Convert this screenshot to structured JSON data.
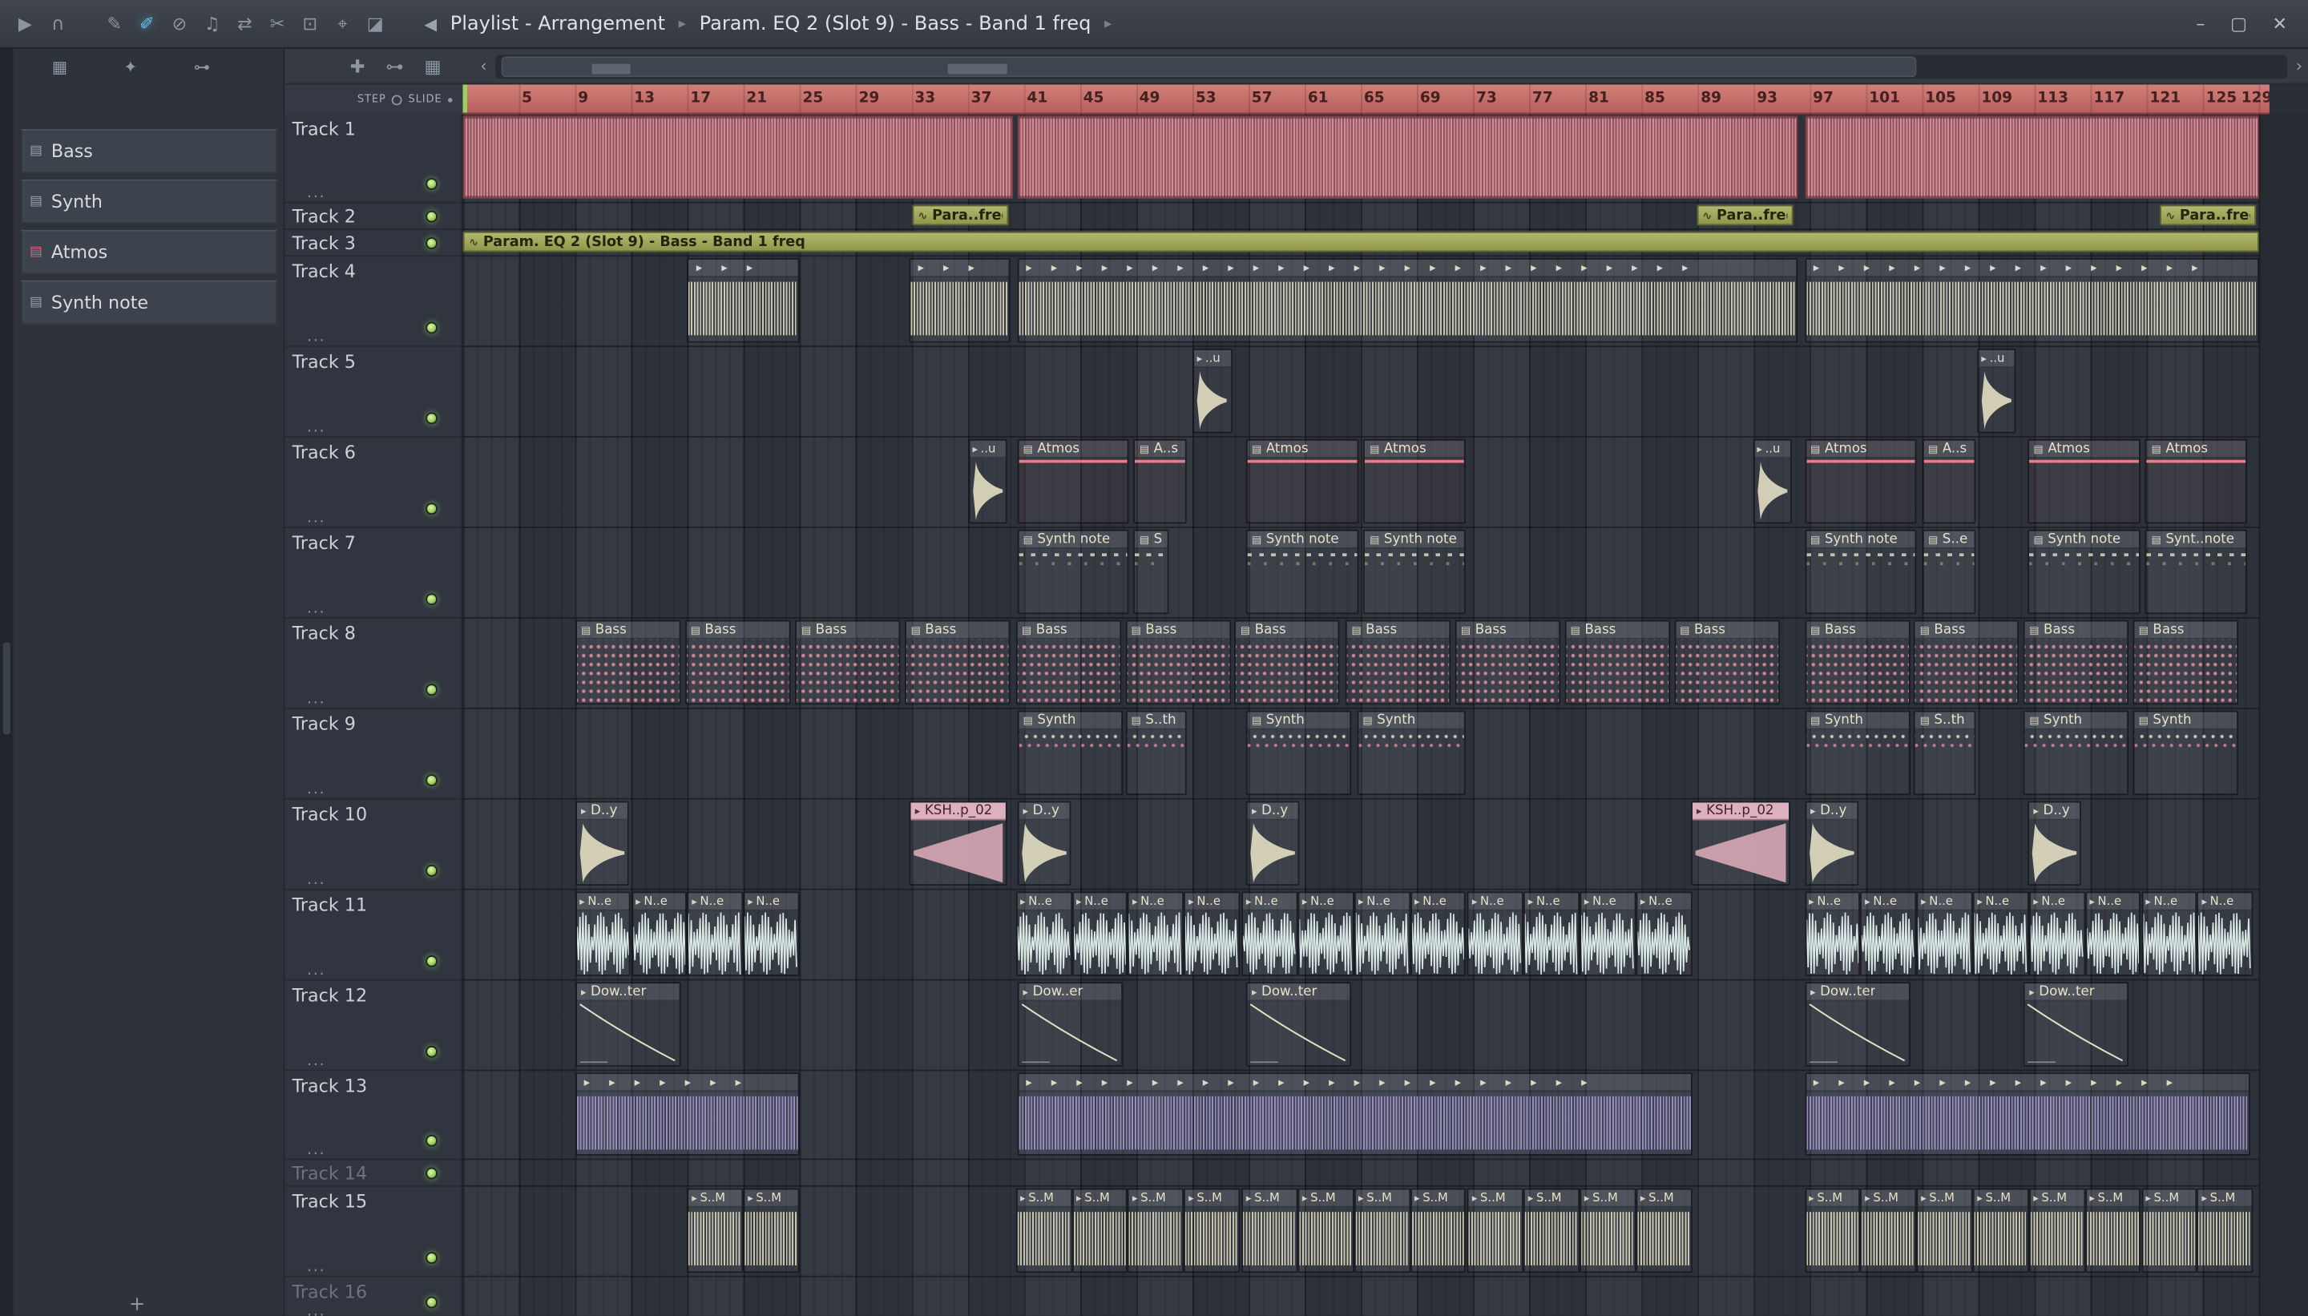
{
  "titlebar": {
    "breadcrumb": [
      "Playlist - Arrangement",
      "Param. EQ 2 (Slot 9) - Bass - Band 1 freq"
    ],
    "sep_glyph": "▸",
    "speaker_glyph": "◀",
    "tools": [
      {
        "name": "play-icon",
        "glyph": "▶"
      },
      {
        "name": "headphones-icon",
        "glyph": "∩"
      },
      {
        "name": "draw-icon",
        "glyph": "✎",
        "gap": true
      },
      {
        "name": "paint-icon",
        "glyph": "✐",
        "accent": "#5fc2ee"
      },
      {
        "name": "delete-icon",
        "glyph": "⊘"
      },
      {
        "name": "mute-icon",
        "glyph": "♫"
      },
      {
        "name": "slip-icon",
        "glyph": "⇄"
      },
      {
        "name": "slice-icon",
        "glyph": "✂"
      },
      {
        "name": "select-icon",
        "glyph": "⊡"
      },
      {
        "name": "zoom-icon",
        "glyph": "⌖"
      },
      {
        "name": "playback-icon",
        "glyph": "◪"
      }
    ],
    "window_buttons": [
      {
        "name": "minimize-button",
        "glyph": "–"
      },
      {
        "name": "maximize-button",
        "glyph": "▢"
      },
      {
        "name": "close-button",
        "glyph": "✕"
      }
    ]
  },
  "picker": {
    "tabs": [
      {
        "name": "pattern-picker-icon",
        "glyph": "▦"
      },
      {
        "name": "audio-picker-icon",
        "glyph": "✦"
      },
      {
        "name": "automation-picker-icon",
        "glyph": "⊶"
      }
    ],
    "items": [
      {
        "label": "Bass",
        "color": "#97a1ac"
      },
      {
        "label": "Synth",
        "color": "#97a1ac"
      },
      {
        "label": "Atmos",
        "color": "#d76872"
      },
      {
        "label": "Synth note",
        "color": "#97a1ac"
      }
    ],
    "add_label": "+"
  },
  "playlist": {
    "tools": [
      {
        "name": "snap-icon",
        "glyph": "✚"
      },
      {
        "name": "slide-icon",
        "glyph": "⊶"
      },
      {
        "name": "grid-icon",
        "glyph": "▦"
      }
    ],
    "scroll_left_glyph": "‹",
    "scroll_right_glyph": "›",
    "step_label": "STEP",
    "slide_label": "SLIDE",
    "ruler_numbers": [
      5,
      9,
      13,
      17,
      21,
      25,
      29,
      33,
      37,
      41,
      45,
      49,
      53,
      57,
      61,
      65,
      69,
      73,
      77,
      81,
      85,
      89,
      93,
      97,
      101,
      105,
      109,
      113,
      117,
      121,
      125,
      129
    ],
    "tracks": [
      {
        "name": "Track 1"
      },
      {
        "name": "Track 2"
      },
      {
        "name": "Track 3"
      },
      {
        "name": "Track 4"
      },
      {
        "name": "Track 5"
      },
      {
        "name": "Track 6"
      },
      {
        "name": "Track 7"
      },
      {
        "name": "Track 8"
      },
      {
        "name": "Track 9"
      },
      {
        "name": "Track 10"
      },
      {
        "name": "Track 11"
      },
      {
        "name": "Track 12"
      },
      {
        "name": "Track 13"
      },
      {
        "name": "Track 14",
        "dim": true
      },
      {
        "name": "Track 15"
      },
      {
        "name": "Track 16",
        "dim": true
      }
    ],
    "clips": [
      {
        "t": 0,
        "s": 1,
        "l": 39.2,
        "k": "pink"
      },
      {
        "t": 0,
        "s": 40.5,
        "l": 55.6,
        "k": "pink"
      },
      {
        "t": 0,
        "s": 96.6,
        "l": 32.4,
        "k": "pink"
      },
      {
        "t": 1,
        "s": 33,
        "l": 6.9,
        "k": "auto",
        "label": "Para..freq"
      },
      {
        "t": 1,
        "s": 88.9,
        "l": 6.9,
        "k": "auto",
        "label": "Para..freq"
      },
      {
        "t": 1,
        "s": 121.9,
        "l": 6.9,
        "k": "auto",
        "label": "Para..freq"
      },
      {
        "t": 2,
        "s": 1,
        "l": 128,
        "k": "auto",
        "label": "Param. EQ 2 (Slot 9) - Bass - Band 1 freq"
      },
      {
        "t": 3,
        "s": 17,
        "l": 8,
        "k": "wave"
      },
      {
        "t": 3,
        "s": 32.8,
        "l": 7.2,
        "k": "wave"
      },
      {
        "t": 3,
        "s": 40.5,
        "l": 55.6,
        "k": "wave"
      },
      {
        "t": 3,
        "s": 96.6,
        "l": 32.4,
        "k": "wave"
      },
      {
        "t": 4,
        "s": 53,
        "l": 2.8,
        "k": "env",
        "label": "..u"
      },
      {
        "t": 4,
        "s": 108.9,
        "l": 2.8,
        "k": "env",
        "label": "..u"
      },
      {
        "t": 5,
        "s": 37,
        "l": 2.8,
        "k": "env",
        "label": "..u"
      },
      {
        "t": 5,
        "s": 40.5,
        "l": 8,
        "k": "atmos",
        "label": "Atmos"
      },
      {
        "t": 5,
        "s": 48.8,
        "l": 3.8,
        "k": "atmos",
        "label": "A..s"
      },
      {
        "t": 5,
        "s": 56.8,
        "l": 8,
        "k": "atmos",
        "label": "Atmos"
      },
      {
        "t": 5,
        "s": 65.2,
        "l": 7.3,
        "k": "atmos",
        "label": "Atmos"
      },
      {
        "t": 5,
        "s": 92.9,
        "l": 2.8,
        "k": "env",
        "label": "..u"
      },
      {
        "t": 5,
        "s": 96.6,
        "l": 8,
        "k": "atmos",
        "label": "Atmos"
      },
      {
        "t": 5,
        "s": 105,
        "l": 3.8,
        "k": "atmos",
        "label": "A..s"
      },
      {
        "t": 5,
        "s": 112.5,
        "l": 8,
        "k": "atmos",
        "label": "Atmos"
      },
      {
        "t": 5,
        "s": 120.9,
        "l": 7.3,
        "k": "atmos",
        "label": "Atmos"
      },
      {
        "t": 6,
        "s": 40.5,
        "l": 8,
        "k": "note",
        "label": "Synth note"
      },
      {
        "t": 6,
        "s": 48.8,
        "l": 2.5,
        "k": "note",
        "label": "S..e"
      },
      {
        "t": 6,
        "s": 56.8,
        "l": 8,
        "k": "note",
        "label": "Synth note"
      },
      {
        "t": 6,
        "s": 65.2,
        "l": 7.3,
        "k": "note",
        "label": "Synth note"
      },
      {
        "t": 6,
        "s": 96.6,
        "l": 8,
        "k": "note",
        "label": "Synth note"
      },
      {
        "t": 6,
        "s": 105,
        "l": 3.8,
        "k": "note",
        "label": "S..e"
      },
      {
        "t": 6,
        "s": 112.5,
        "l": 8,
        "k": "note",
        "label": "Synth note"
      },
      {
        "t": 6,
        "s": 120.9,
        "l": 7.3,
        "k": "note",
        "label": "Synt..note"
      },
      {
        "t": 7,
        "s": 9,
        "l": 7.5,
        "k": "bass",
        "label": "Bass"
      },
      {
        "t": 7,
        "s": 16.8,
        "l": 7.5,
        "k": "bass",
        "label": "Bass"
      },
      {
        "t": 7,
        "s": 24.7,
        "l": 7.5,
        "k": "bass",
        "label": "Bass"
      },
      {
        "t": 7,
        "s": 32.5,
        "l": 7.5,
        "k": "bass",
        "label": "Bass"
      },
      {
        "t": 7,
        "s": 40.4,
        "l": 7.5,
        "k": "bass",
        "label": "Bass"
      },
      {
        "t": 7,
        "s": 48.2,
        "l": 7.5,
        "k": "bass",
        "label": "Bass"
      },
      {
        "t": 7,
        "s": 56,
        "l": 7.5,
        "k": "bass",
        "label": "Bass"
      },
      {
        "t": 7,
        "s": 63.9,
        "l": 7.5,
        "k": "bass",
        "label": "Bass"
      },
      {
        "t": 7,
        "s": 71.7,
        "l": 7.5,
        "k": "bass",
        "label": "Bass"
      },
      {
        "t": 7,
        "s": 79.5,
        "l": 7.5,
        "k": "bass",
        "label": "Bass"
      },
      {
        "t": 7,
        "s": 87.3,
        "l": 7.5,
        "k": "bass",
        "label": "Bass"
      },
      {
        "t": 7,
        "s": 96.6,
        "l": 7.5,
        "k": "bass",
        "label": "Bass"
      },
      {
        "t": 7,
        "s": 104.4,
        "l": 7.5,
        "k": "bass",
        "label": "Bass"
      },
      {
        "t": 7,
        "s": 112.2,
        "l": 7.5,
        "k": "bass",
        "label": "Bass"
      },
      {
        "t": 7,
        "s": 120,
        "l": 7.5,
        "k": "bass",
        "label": "Bass"
      },
      {
        "t": 8,
        "s": 40.5,
        "l": 7.5,
        "k": "synth",
        "label": "Synth"
      },
      {
        "t": 8,
        "s": 48.2,
        "l": 4.4,
        "k": "synth",
        "label": "S..th"
      },
      {
        "t": 8,
        "s": 56.8,
        "l": 7.5,
        "k": "synth",
        "label": "Synth"
      },
      {
        "t": 8,
        "s": 64.7,
        "l": 7.8,
        "k": "synth",
        "label": "Synth"
      },
      {
        "t": 8,
        "s": 96.6,
        "l": 7.5,
        "k": "synth",
        "label": "Synth"
      },
      {
        "t": 8,
        "s": 104.4,
        "l": 4.4,
        "k": "synth",
        "label": "S..th"
      },
      {
        "t": 8,
        "s": 112.2,
        "l": 7.5,
        "k": "synth",
        "label": "Synth"
      },
      {
        "t": 8,
        "s": 120,
        "l": 7.5,
        "k": "synth",
        "label": "Synth"
      },
      {
        "t": 9,
        "s": 9,
        "l": 3.8,
        "k": "decay",
        "label": "D..y"
      },
      {
        "t": 9,
        "s": 32.8,
        "l": 7,
        "k": "rev",
        "label": "KSH..p_02"
      },
      {
        "t": 9,
        "s": 40.5,
        "l": 3.8,
        "k": "decay",
        "label": "D..y"
      },
      {
        "t": 9,
        "s": 56.8,
        "l": 3.8,
        "k": "decay",
        "label": "D..y"
      },
      {
        "t": 9,
        "s": 88.5,
        "l": 7.1,
        "k": "rev",
        "label": "KSH..p_02"
      },
      {
        "t": 9,
        "s": 96.6,
        "l": 3.8,
        "k": "decay",
        "label": "D..y"
      },
      {
        "t": 9,
        "s": 112.5,
        "l": 3.8,
        "k": "decay",
        "label": "D..y"
      },
      {
        "t": 10,
        "s": 9,
        "l": 4,
        "k": "noise",
        "label": "N..e"
      },
      {
        "t": 10,
        "s": 13,
        "l": 4,
        "k": "noise",
        "label": "N..e"
      },
      {
        "t": 10,
        "s": 17,
        "l": 4,
        "k": "noise",
        "label": "N..e"
      },
      {
        "t": 10,
        "s": 21,
        "l": 4,
        "k": "noise",
        "label": "N..e"
      },
      {
        "t": 10,
        "s": 40.4,
        "l": 4,
        "k": "noise",
        "label": "N..e"
      },
      {
        "t": 10,
        "s": 44.4,
        "l": 4,
        "k": "noise",
        "label": "N..e"
      },
      {
        "t": 10,
        "s": 48.4,
        "l": 4,
        "k": "noise",
        "label": "N..e"
      },
      {
        "t": 10,
        "s": 52.4,
        "l": 4,
        "k": "noise",
        "label": "N..e"
      },
      {
        "t": 10,
        "s": 56.5,
        "l": 4,
        "k": "noise",
        "label": "N..e"
      },
      {
        "t": 10,
        "s": 60.5,
        "l": 4,
        "k": "noise",
        "label": "N..e"
      },
      {
        "t": 10,
        "s": 64.5,
        "l": 4,
        "k": "noise",
        "label": "N..e"
      },
      {
        "t": 10,
        "s": 68.5,
        "l": 4,
        "k": "noise",
        "label": "N..e"
      },
      {
        "t": 10,
        "s": 72.6,
        "l": 4,
        "k": "noise",
        "label": "N..e"
      },
      {
        "t": 10,
        "s": 76.6,
        "l": 4,
        "k": "noise",
        "label": "N..e"
      },
      {
        "t": 10,
        "s": 80.6,
        "l": 4,
        "k": "noise",
        "label": "N..e"
      },
      {
        "t": 10,
        "s": 84.6,
        "l": 4,
        "k": "noise",
        "label": "N..e"
      },
      {
        "t": 10,
        "s": 96.6,
        "l": 4,
        "k": "noise",
        "label": "N..e"
      },
      {
        "t": 10,
        "s": 100.6,
        "l": 4,
        "k": "noise",
        "label": "N..e"
      },
      {
        "t": 10,
        "s": 104.6,
        "l": 4,
        "k": "noise",
        "label": "N..e"
      },
      {
        "t": 10,
        "s": 108.6,
        "l": 4,
        "k": "noise",
        "label": "N..e"
      },
      {
        "t": 10,
        "s": 112.6,
        "l": 4,
        "k": "noise",
        "label": "N..e"
      },
      {
        "t": 10,
        "s": 116.6,
        "l": 4,
        "k": "noise",
        "label": "N..e"
      },
      {
        "t": 10,
        "s": 120.6,
        "l": 4,
        "k": "noise",
        "label": "N..e"
      },
      {
        "t": 10,
        "s": 124.6,
        "l": 4,
        "k": "noise",
        "label": "N..e"
      },
      {
        "t": 11,
        "s": 9,
        "l": 7.5,
        "k": "down",
        "label": "Dow..ter"
      },
      {
        "t": 11,
        "s": 40.5,
        "l": 7.5,
        "k": "down",
        "label": "Dow..er"
      },
      {
        "t": 11,
        "s": 56.8,
        "l": 7.5,
        "k": "down",
        "label": "Dow..ter"
      },
      {
        "t": 11,
        "s": 96.6,
        "l": 7.5,
        "k": "down",
        "label": "Dow..ter"
      },
      {
        "t": 11,
        "s": 112.2,
        "l": 7.5,
        "k": "down",
        "label": "Dow..ter"
      },
      {
        "t": 12,
        "s": 9,
        "l": 16,
        "k": "purple"
      },
      {
        "t": 12,
        "s": 40.5,
        "l": 48.1,
        "k": "purple"
      },
      {
        "t": 12,
        "s": 96.6,
        "l": 31.8,
        "k": "purple"
      },
      {
        "t": 14,
        "s": 17,
        "l": 4,
        "k": "sm",
        "label": "S..M"
      },
      {
        "t": 14,
        "s": 21,
        "l": 4,
        "k": "sm",
        "label": "S..M"
      },
      {
        "t": 14,
        "s": 40.4,
        "l": 4,
        "k": "sm",
        "label": "S..M"
      },
      {
        "t": 14,
        "s": 44.4,
        "l": 4,
        "k": "sm",
        "label": "S..M"
      },
      {
        "t": 14,
        "s": 48.4,
        "l": 4,
        "k": "sm",
        "label": "S..M"
      },
      {
        "t": 14,
        "s": 52.4,
        "l": 4,
        "k": "sm",
        "label": "S..M"
      },
      {
        "t": 14,
        "s": 56.5,
        "l": 4,
        "k": "sm",
        "label": "S..M"
      },
      {
        "t": 14,
        "s": 60.5,
        "l": 4,
        "k": "sm",
        "label": "S..M"
      },
      {
        "t": 14,
        "s": 64.5,
        "l": 4,
        "k": "sm",
        "label": "S..M"
      },
      {
        "t": 14,
        "s": 68.5,
        "l": 4,
        "k": "sm",
        "label": "S..M"
      },
      {
        "t": 14,
        "s": 72.6,
        "l": 4,
        "k": "sm",
        "label": "S..M"
      },
      {
        "t": 14,
        "s": 76.6,
        "l": 4,
        "k": "sm",
        "label": "S..M"
      },
      {
        "t": 14,
        "s": 80.6,
        "l": 4,
        "k": "sm",
        "label": "S..M"
      },
      {
        "t": 14,
        "s": 84.6,
        "l": 4,
        "k": "sm",
        "label": "S..M"
      },
      {
        "t": 14,
        "s": 96.6,
        "l": 4,
        "k": "sm",
        "label": "S..M"
      },
      {
        "t": 14,
        "s": 100.6,
        "l": 4,
        "k": "sm",
        "label": "S..M"
      },
      {
        "t": 14,
        "s": 104.6,
        "l": 4,
        "k": "sm",
        "label": "S..M"
      },
      {
        "t": 14,
        "s": 108.6,
        "l": 4,
        "k": "sm",
        "label": "S..M"
      },
      {
        "t": 14,
        "s": 112.6,
        "l": 4,
        "k": "sm",
        "label": "S..M"
      },
      {
        "t": 14,
        "s": 116.6,
        "l": 4,
        "k": "sm",
        "label": "S..M"
      },
      {
        "t": 14,
        "s": 120.6,
        "l": 4,
        "k": "sm",
        "label": "S..M"
      },
      {
        "t": 14,
        "s": 124.6,
        "l": 4,
        "k": "sm",
        "label": "S..M"
      }
    ]
  },
  "colors": {
    "cream": "#e3dfc2",
    "pink_wave": "#e2afbc",
    "cyan": "#d9e8e4",
    "olive": "#a2a75c",
    "atmos_line": "#e57f85",
    "led": "#9ed25f"
  }
}
